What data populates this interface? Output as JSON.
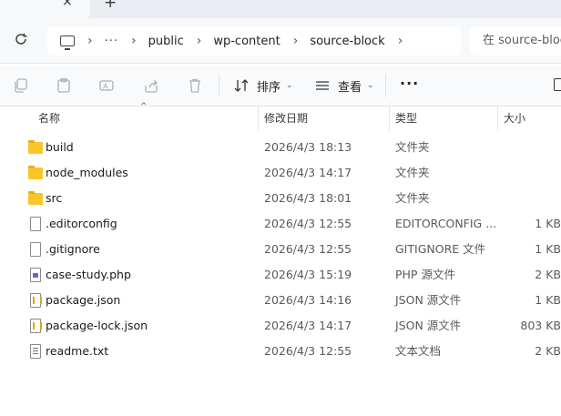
{
  "tabs": {
    "close_glyph": "×",
    "new_glyph": "+"
  },
  "address": {
    "ellipsis": "···",
    "crumbs": [
      "public",
      "wp-content",
      "source-block"
    ]
  },
  "search": {
    "placeholder": "在 source-block 中搜索"
  },
  "toolbar": {
    "sort_label": "排序",
    "view_label": "查看",
    "more_label": "···",
    "icons": [
      "copy-icon",
      "paste-icon",
      "rename-icon",
      "share-icon",
      "delete-icon",
      "sort-icon",
      "view-icon",
      "details-icon"
    ]
  },
  "columns": {
    "name": "名称",
    "date": "修改日期",
    "type": "类型",
    "size": "大小"
  },
  "files": [
    {
      "name": "build",
      "date": "2026/4/3 18:13",
      "type": "文件夹",
      "size": "",
      "icon": "folder-icon"
    },
    {
      "name": "node_modules",
      "date": "2026/4/3 14:17",
      "type": "文件夹",
      "size": "",
      "icon": "folder-icon"
    },
    {
      "name": "src",
      "date": "2026/4/3 18:01",
      "type": "文件夹",
      "size": "",
      "icon": "folder-icon"
    },
    {
      "name": ".editorconfig",
      "date": "2026/4/3 12:55",
      "type": "EDITORCONFIG ...",
      "size": "1 KB",
      "icon": "file-icon"
    },
    {
      "name": ".gitignore",
      "date": "2026/4/3 12:55",
      "type": "GITIGNORE 文件",
      "size": "1 KB",
      "icon": "file-icon"
    },
    {
      "name": "case-study.php",
      "date": "2026/4/3 15:19",
      "type": "PHP 源文件",
      "size": "2 KB",
      "icon": "php-file-icon"
    },
    {
      "name": "package.json",
      "date": "2026/4/3 14:16",
      "type": "JSON 源文件",
      "size": "1 KB",
      "icon": "json-file-icon"
    },
    {
      "name": "package-lock.json",
      "date": "2026/4/3 14:17",
      "type": "JSON 源文件",
      "size": "803 KB",
      "icon": "json-file-icon"
    },
    {
      "name": "readme.txt",
      "date": "2026/4/3 12:55",
      "type": "文本文档",
      "size": "2 KB",
      "icon": "text-file-icon"
    }
  ]
}
